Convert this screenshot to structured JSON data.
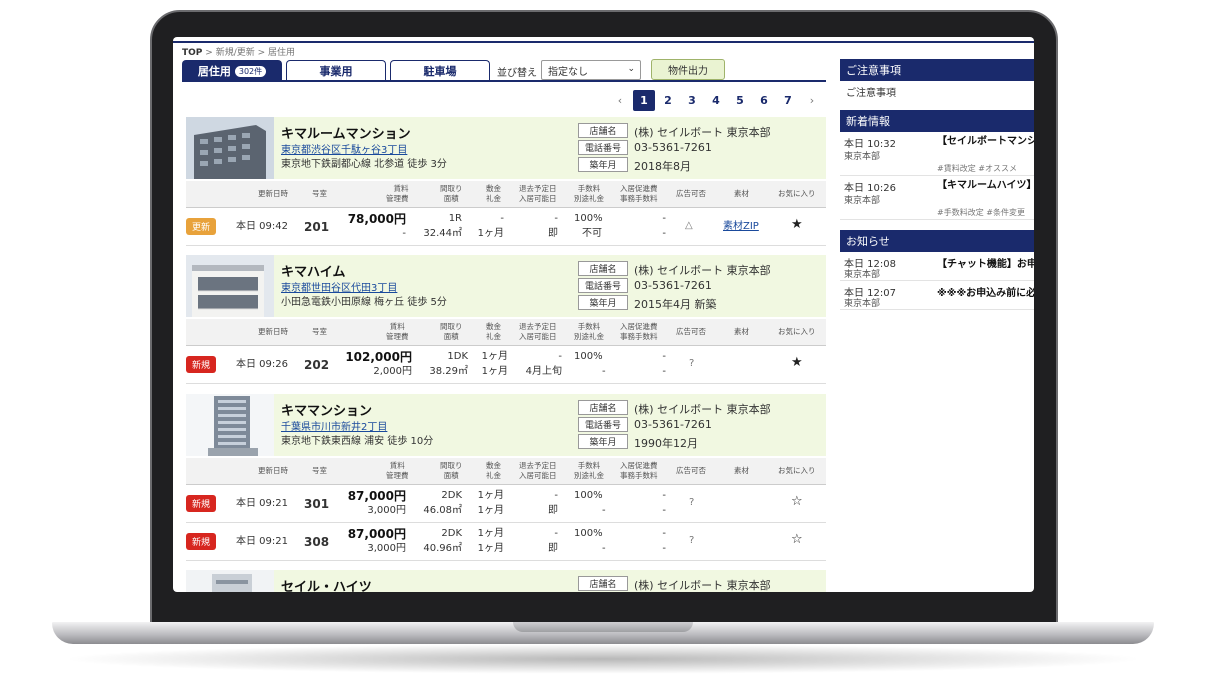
{
  "breadcrumb": {
    "top": "TOP",
    "sep1": ">",
    "mid": "新規/更新",
    "sep2": ">",
    "cur": "居住用"
  },
  "tabs": [
    {
      "label": "居住用",
      "count": "302件"
    },
    {
      "label": "事業用"
    },
    {
      "label": "駐車場"
    }
  ],
  "sort": {
    "label": "並び替え",
    "value": "指定なし"
  },
  "export_button": "物件出力",
  "pager": {
    "prev": "‹",
    "pages": [
      "1",
      "2",
      "3",
      "4",
      "5",
      "6",
      "7"
    ],
    "next": "›",
    "current": "1"
  },
  "labels": {
    "shop": "店舗名",
    "phone": "電話番号",
    "built": "築年月"
  },
  "table_headers": {
    "updated": "更新日時",
    "room": "号室",
    "rent": "賃料",
    "mgmt": "管理費",
    "layout": "間取り",
    "area": "面積",
    "deposit": "敷金",
    "key": "礼金",
    "vacate": "退去予定日",
    "movein": "入居可能日",
    "fee": "手数料",
    "sep_key": "別途礼金",
    "promo": "入居促進費",
    "office": "事務手数料",
    "ad": "広告可否",
    "material": "素材",
    "fav": "お気に入り"
  },
  "buildings": [
    {
      "name": "キマルームマンション",
      "address": "東京都渋谷区千駄ヶ谷3丁目",
      "transit": "東京地下鉄副都心線 北参道 徒歩 3分",
      "shop": "(株) セイルボート 東京本部",
      "phone": "03-5361-7261",
      "built": "2018年8月",
      "rooms": [
        {
          "badge": "更新",
          "time": "本日 09:42",
          "room": "201",
          "rent": "78,000円",
          "mgmt": "-",
          "layout": "1R",
          "area": "32.44㎡",
          "deposit": "-",
          "key": "1ヶ月",
          "vacate": "-",
          "movein": "即",
          "fee": "100%",
          "sep": "不可",
          "promo": "-",
          "office": "-",
          "ad": "△",
          "material": "素材ZIP",
          "fav": "★"
        }
      ]
    },
    {
      "name": "キマハイム",
      "address": "東京都世田谷区代田3丁目",
      "transit": "小田急電鉄小田原線 梅ヶ丘 徒歩 5分",
      "shop": "(株) セイルボート 東京本部",
      "phone": "03-5361-7261",
      "built": "2015年4月 新築",
      "rooms": [
        {
          "badge": "新規",
          "time": "本日 09:26",
          "room": "202",
          "rent": "102,000円",
          "mgmt": "2,000円",
          "layout": "1DK",
          "area": "38.29㎡",
          "deposit": "1ヶ月",
          "key": "1ヶ月",
          "vacate": "-",
          "movein": "4月上旬",
          "fee": "100%",
          "sep": "-",
          "promo": "-",
          "office": "-",
          "ad": "?",
          "material": "",
          "fav": "★"
        }
      ]
    },
    {
      "name": "キママンション",
      "address": "千葉県市川市新井2丁目",
      "transit": "東京地下鉄東西線 浦安 徒歩 10分",
      "shop": "(株) セイルボート 東京本部",
      "phone": "03-5361-7261",
      "built": "1990年12月",
      "rooms": [
        {
          "badge": "新規",
          "time": "本日 09:21",
          "room": "301",
          "rent": "87,000円",
          "mgmt": "3,000円",
          "layout": "2DK",
          "area": "46.08㎡",
          "deposit": "1ヶ月",
          "key": "1ヶ月",
          "vacate": "-",
          "movein": "即",
          "fee": "100%",
          "sep": "-",
          "promo": "-",
          "office": "-",
          "ad": "?",
          "material": "",
          "fav": "☆"
        },
        {
          "badge": "新規",
          "time": "本日 09:21",
          "room": "308",
          "rent": "87,000円",
          "mgmt": "3,000円",
          "layout": "2DK",
          "area": "40.96㎡",
          "deposit": "1ヶ月",
          "key": "1ヶ月",
          "vacate": "-",
          "movein": "即",
          "fee": "100%",
          "sep": "-",
          "promo": "-",
          "office": "-",
          "ad": "?",
          "material": "",
          "fav": "☆"
        }
      ]
    },
    {
      "name": "セイル・ハイツ",
      "shop": "(株) セイルボート 東京本部"
    }
  ],
  "sidebar": {
    "notice": {
      "title": "ご注意事項",
      "body": "ご注意事項"
    },
    "news": {
      "title": "新着情報",
      "items": [
        {
          "time": "本日 10:32",
          "owner": "東京本部",
          "headline": "【セイルボートマンション！",
          "tags": "#賃料改定 #オススメ"
        },
        {
          "time": "本日 10:26",
          "owner": "東京本部",
          "headline": "【キマルームハイツ】増額！",
          "tags": "#手数料改定 #条件変更"
        }
      ]
    },
    "info": {
      "title": "お知らせ",
      "items": [
        {
          "time": "本日 12:08",
          "owner": "東京本部",
          "headline": "【チャット機能】お申"
        },
        {
          "time": "本日 12:07",
          "owner": "東京本部",
          "headline": "※※※お申込み前に必"
        }
      ]
    }
  }
}
